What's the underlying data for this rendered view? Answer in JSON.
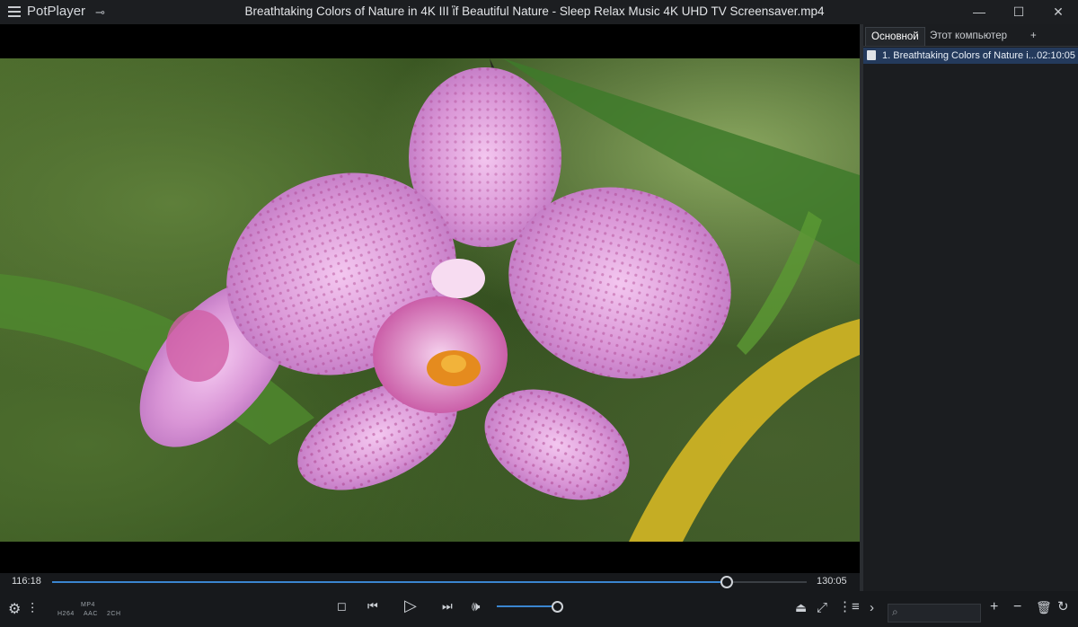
{
  "app": {
    "name": "PotPlayer",
    "title": "Breathtaking Colors of Nature in 4K III ἳf Beautiful Nature - Sleep Relax Music 4K UHD TV Screensaver.mp4"
  },
  "window_controls": {
    "minimize": "—",
    "maximize": "☐",
    "close": "✕"
  },
  "playlist": {
    "tabs": [
      "Основной",
      "Этот компьютер",
      "+"
    ],
    "items": [
      {
        "label": "1. Breathtaking Colors of Nature i...",
        "duration": "02:10:05"
      }
    ]
  },
  "player": {
    "current_time": "116:18",
    "total_time": "130:05",
    "progress": 0.894,
    "volume": 1.0,
    "codec": {
      "container": "MP4",
      "video": "H264",
      "audio": "AAC",
      "channels": "2CH"
    }
  },
  "icons": {
    "settings": "gear-icon",
    "equalizer": "sliders-icon",
    "stop": "stop-icon",
    "prev": "previous-icon",
    "play": "play-icon",
    "next": "next-icon",
    "volume": "speaker-icon",
    "eject": "eject-icon",
    "fullscreen": "fullscreen-icon",
    "playlist": "playlist-icon",
    "expand": "chevron-right-icon",
    "search": "search-icon",
    "add": "plus-icon",
    "remove": "minus-icon",
    "delete": "trash-icon",
    "repeat": "repeat-icon"
  },
  "colors": {
    "accent": "#3a85cf",
    "background": "#17191c",
    "selection": "#243a5c"
  }
}
